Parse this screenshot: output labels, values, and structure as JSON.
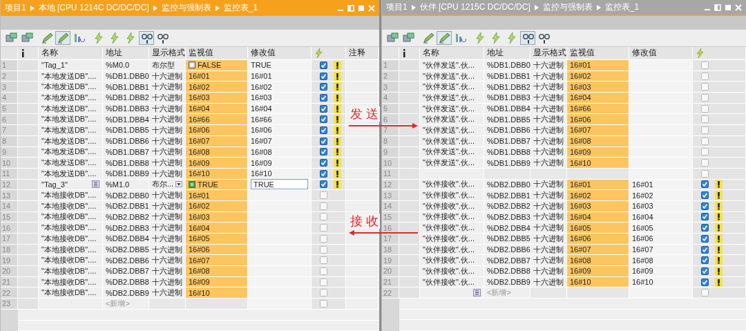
{
  "panels": [
    {
      "active": true,
      "breadcrumbs": [
        "项目1",
        "本地 [CPU 1214C DC/DC/DC]",
        "监控与强制表",
        "监控表_1"
      ],
      "toolbar": [
        {
          "kind": "table",
          "pressed": false
        },
        {
          "kind": "table",
          "pressed": false
        },
        {
          "kind": "pencil",
          "pressed": false
        },
        {
          "kind": "pencil",
          "pressed": true
        },
        {
          "kind": "chart",
          "pressed": false
        },
        {
          "kind": "lightning",
          "pressed": false
        },
        {
          "kind": "lightning",
          "pressed": false
        },
        {
          "kind": "lightning",
          "pressed": false
        },
        {
          "kind": "glasses",
          "pressed": true
        },
        {
          "kind": "glasses",
          "pressed": false
        }
      ],
      "columns": [
        {
          "kind": "number"
        },
        {
          "kind": "info"
        },
        {
          "kind": "name",
          "label": "名称"
        },
        {
          "kind": "address",
          "label": "地址"
        },
        {
          "kind": "format",
          "label": "显示格式"
        },
        {
          "kind": "monitor",
          "label": "监视值"
        },
        {
          "kind": "modify",
          "label": "修改值"
        },
        {
          "kind": "force"
        },
        {
          "kind": "comment",
          "label": "注释"
        }
      ],
      "rows": [
        {
          "kind": "tag",
          "no": "1",
          "name": "\"Tag_1\"",
          "address": "%M0.0",
          "format": "布尔型",
          "monitor": "FALSE",
          "signal": false,
          "modify": "TRUE",
          "forced": true,
          "warning": true
        },
        {
          "kind": "tag",
          "no": "2",
          "name": "\"本地发送DB\"....",
          "address": "%DB1.DBB0",
          "format": "十六进制",
          "monitor": "16#01",
          "modify": "16#01",
          "forced": true,
          "warning": true
        },
        {
          "kind": "tag",
          "no": "3",
          "name": "\"本地发送DB\"....",
          "address": "%DB1.DBB1",
          "format": "十六进制",
          "monitor": "16#02",
          "modify": "16#02",
          "forced": true,
          "warning": true
        },
        {
          "kind": "tag",
          "no": "4",
          "name": "\"本地发送DB\"....",
          "address": "%DB1.DBB2",
          "format": "十六进制",
          "monitor": "16#03",
          "modify": "16#03",
          "forced": true,
          "warning": true
        },
        {
          "kind": "tag",
          "no": "5",
          "name": "\"本地发送DB\"....",
          "address": "%DB1.DBB3",
          "format": "十六进制",
          "monitor": "16#04",
          "modify": "16#04",
          "forced": true,
          "warning": true
        },
        {
          "kind": "tag",
          "no": "6",
          "name": "\"本地发送DB\"....",
          "address": "%DB1.DBB4",
          "format": "十六进制",
          "monitor": "16#66",
          "modify": "16#66",
          "forced": true,
          "warning": true
        },
        {
          "kind": "tag",
          "no": "7",
          "name": "\"本地发送DB\"....",
          "address": "%DB1.DBB5",
          "format": "十六进制",
          "monitor": "16#06",
          "modify": "16#06",
          "forced": true,
          "warning": true
        },
        {
          "kind": "tag",
          "no": "8",
          "name": "\"本地发送DB\"....",
          "address": "%DB1.DBB6",
          "format": "十六进制",
          "monitor": "16#07",
          "modify": "16#07",
          "forced": true,
          "warning": true
        },
        {
          "kind": "tag",
          "no": "9",
          "name": "\"本地发送DB\"....",
          "address": "%DB1.DBB7",
          "format": "十六进制",
          "monitor": "16#08",
          "modify": "16#08",
          "forced": true,
          "warning": true
        },
        {
          "kind": "tag",
          "no": "10",
          "name": "\"本地发送DB\"....",
          "address": "%DB1.DBB8",
          "format": "十六进制",
          "monitor": "16#09",
          "modify": "16#09",
          "forced": true,
          "warning": true
        },
        {
          "kind": "tag",
          "no": "11",
          "name": "\"本地发送DB\"....",
          "address": "%DB1.DBB9",
          "format": "十六进制",
          "monitor": "16#10",
          "modify": "16#10",
          "forced": true,
          "warning": true
        },
        {
          "kind": "tag",
          "no": "12",
          "name": "\"Tag_3\"",
          "name_button": true,
          "address": "%M1.0",
          "format": "布尔...",
          "format_dropdown": true,
          "monitor": "TRUE",
          "signal": true,
          "modify": "TRUE",
          "editing": true,
          "forced": true,
          "warning": true
        },
        {
          "kind": "tag",
          "no": "13",
          "name": "\"本地接收DB\"....",
          "address": "%DB2.DBB0",
          "format": "十六进制",
          "monitor": "16#01",
          "forced": false,
          "warning": false
        },
        {
          "kind": "tag",
          "no": "14",
          "name": "\"本地接收DB\"....",
          "address": "%DB2.DBB1",
          "format": "十六进制",
          "monitor": "16#02",
          "forced": false,
          "warning": false
        },
        {
          "kind": "tag",
          "no": "15",
          "name": "\"本地接收DB\"....",
          "address": "%DB2.DBB2",
          "format": "十六进制",
          "monitor": "16#03",
          "forced": false,
          "warning": false
        },
        {
          "kind": "tag",
          "no": "16",
          "name": "\"本地接收DB\"....",
          "address": "%DB2.DBB3",
          "format": "十六进制",
          "monitor": "16#04",
          "forced": false,
          "warning": false
        },
        {
          "kind": "tag",
          "no": "17",
          "name": "\"本地接收DB\"....",
          "address": "%DB2.DBB4",
          "format": "十六进制",
          "monitor": "16#05",
          "forced": false,
          "warning": false
        },
        {
          "kind": "tag",
          "no": "18",
          "name": "\"本地接收DB\"....",
          "address": "%DB2.DBB5",
          "format": "十六进制",
          "monitor": "16#06",
          "forced": false,
          "warning": false
        },
        {
          "kind": "tag",
          "no": "19",
          "name": "\"本地接收DB\"....",
          "address": "%DB2.DBB6",
          "format": "十六进制",
          "monitor": "16#07",
          "forced": false,
          "warning": false
        },
        {
          "kind": "tag",
          "no": "20",
          "name": "\"本地接收DB\"....",
          "address": "%DB2.DBB7",
          "format": "十六进制",
          "monitor": "16#08",
          "forced": false,
          "warning": false
        },
        {
          "kind": "tag",
          "no": "21",
          "name": "\"本地接收DB\"....",
          "address": "%DB2.DBB8",
          "format": "十六进制",
          "monitor": "16#09",
          "forced": false,
          "warning": false
        },
        {
          "kind": "tag",
          "no": "22",
          "name": "\"本地接收DB\"....",
          "address": "%DB2.DBB9",
          "format": "十六进制",
          "monitor": "16#10",
          "forced": false,
          "warning": false
        },
        {
          "kind": "new",
          "no": "23",
          "address": "<新增>",
          "forced": false,
          "warning": false
        }
      ]
    },
    {
      "active": false,
      "breadcrumbs": [
        "项目1",
        "伙伴 [CPU 1215C DC/DC/DC]",
        "监控与强制表",
        "监控表_1"
      ],
      "toolbar": [
        {
          "kind": "table",
          "pressed": false
        },
        {
          "kind": "table",
          "pressed": false
        },
        {
          "kind": "pencil",
          "pressed": false
        },
        {
          "kind": "pencil",
          "pressed": true
        },
        {
          "kind": "chart",
          "pressed": false
        },
        {
          "kind": "lightning",
          "pressed": false
        },
        {
          "kind": "lightning",
          "pressed": false
        },
        {
          "kind": "lightning",
          "pressed": false
        },
        {
          "kind": "glasses",
          "pressed": true
        },
        {
          "kind": "glasses",
          "pressed": false
        }
      ],
      "columns": [
        {
          "kind": "number"
        },
        {
          "kind": "info"
        },
        {
          "kind": "name",
          "label": "名称"
        },
        {
          "kind": "address",
          "label": "地址"
        },
        {
          "kind": "format",
          "label": "显示格式"
        },
        {
          "kind": "monitor",
          "label": "监视值"
        },
        {
          "kind": "modify",
          "label": "修改值"
        },
        {
          "kind": "force"
        }
      ],
      "rows": [
        {
          "kind": "tag",
          "no": "1",
          "name": "\"伙伴发送\".伙...",
          "address": "%DB1.DBB0",
          "format": "十六进制",
          "monitor": "16#01",
          "forced": false,
          "warning": false
        },
        {
          "kind": "tag",
          "no": "2",
          "name": "\"伙伴发送\".伙...",
          "address": "%DB1.DBB1",
          "format": "十六进制",
          "monitor": "16#02",
          "forced": false,
          "warning": false
        },
        {
          "kind": "tag",
          "no": "3",
          "name": "\"伙伴发送\".伙...",
          "address": "%DB1.DBB2",
          "format": "十六进制",
          "monitor": "16#03",
          "forced": false,
          "warning": false
        },
        {
          "kind": "tag",
          "no": "4",
          "name": "\"伙伴发送\".伙...",
          "address": "%DB1.DBB3",
          "format": "十六进制",
          "monitor": "16#04",
          "forced": false,
          "warning": false
        },
        {
          "kind": "tag",
          "no": "5",
          "name": "\"伙伴发送\".伙...",
          "address": "%DB1.DBB4",
          "format": "十六进制",
          "monitor": "16#66",
          "forced": false,
          "warning": false
        },
        {
          "kind": "tag",
          "no": "6",
          "name": "\"伙伴发送\".伙...",
          "address": "%DB1.DBB5",
          "format": "十六进制",
          "monitor": "16#06",
          "forced": false,
          "warning": false
        },
        {
          "kind": "tag",
          "no": "7",
          "name": "\"伙伴发送\".伙...",
          "address": "%DB1.DBB6",
          "format": "十六进制",
          "monitor": "16#07",
          "forced": false,
          "warning": false
        },
        {
          "kind": "tag",
          "no": "8",
          "name": "\"伙伴发送\".伙...",
          "address": "%DB1.DBB7",
          "format": "十六进制",
          "monitor": "16#08",
          "forced": false,
          "warning": false
        },
        {
          "kind": "tag",
          "no": "9",
          "name": "\"伙伴发送\".伙...",
          "address": "%DB1.DBB8",
          "format": "十六进制",
          "monitor": "16#09",
          "forced": false,
          "warning": false
        },
        {
          "kind": "tag",
          "no": "10",
          "name": "\"伙伴发送\".伙...",
          "address": "%DB1.DBB9",
          "format": "十六进制",
          "monitor": "16#10",
          "forced": false,
          "warning": false
        },
        {
          "kind": "empty",
          "no": "11",
          "forced": false,
          "warning": false
        },
        {
          "kind": "tag",
          "no": "12",
          "name": "\"伙伴接收\".伙...",
          "address": "%DB2.DBB0",
          "format": "十六进制",
          "monitor": "16#01",
          "modify": "16#01",
          "forced": true,
          "warning": true
        },
        {
          "kind": "tag",
          "no": "13",
          "name": "\"伙伴接收\".伙...",
          "address": "%DB2.DBB1",
          "format": "十六进制",
          "monitor": "16#02",
          "modify": "16#02",
          "forced": true,
          "warning": true
        },
        {
          "kind": "tag",
          "no": "14",
          "name": "\"伙伴接收\".伙...",
          "address": "%DB2.DBB2",
          "format": "十六进制",
          "monitor": "16#03",
          "modify": "16#03",
          "forced": true,
          "warning": true
        },
        {
          "kind": "tag",
          "no": "15",
          "name": "\"伙伴接收\".伙...",
          "address": "%DB2.DBB3",
          "format": "十六进制",
          "monitor": "16#04",
          "modify": "16#04",
          "forced": true,
          "warning": true
        },
        {
          "kind": "tag",
          "no": "16",
          "name": "\"伙伴接收\".伙...",
          "address": "%DB2.DBB4",
          "format": "十六进制",
          "monitor": "16#05",
          "modify": "16#05",
          "forced": true,
          "warning": true
        },
        {
          "kind": "tag",
          "no": "17",
          "name": "\"伙伴接收\".伙...",
          "address": "%DB2.DBB5",
          "format": "十六进制",
          "monitor": "16#06",
          "modify": "16#06",
          "forced": true,
          "warning": true
        },
        {
          "kind": "tag",
          "no": "18",
          "name": "\"伙伴接收\".伙...",
          "address": "%DB2.DBB6",
          "format": "十六进制",
          "monitor": "16#07",
          "modify": "16#07",
          "forced": true,
          "warning": true
        },
        {
          "kind": "tag",
          "no": "19",
          "name": "\"伙伴接收\".伙...",
          "address": "%DB2.DBB7",
          "format": "十六进制",
          "monitor": "16#08",
          "modify": "16#08",
          "forced": true,
          "warning": true
        },
        {
          "kind": "tag",
          "no": "20",
          "name": "\"伙伴接收\".伙...",
          "address": "%DB2.DBB8",
          "format": "十六进制",
          "monitor": "16#09",
          "modify": "16#09",
          "forced": true,
          "warning": true
        },
        {
          "kind": "tag",
          "no": "21",
          "name": "\"伙伴接收\".伙...",
          "address": "%DB2.DBB9",
          "format": "十六进制",
          "monitor": "16#10",
          "modify": "16#10",
          "forced": true,
          "warning": true
        },
        {
          "kind": "new",
          "no": "22",
          "name_button": true,
          "address": "<新增>",
          "forced": false,
          "warning": false
        }
      ]
    }
  ],
  "annotations": [
    {
      "text": "发 送",
      "kind": "rightward"
    },
    {
      "text": "接 收",
      "kind": "leftward"
    }
  ]
}
